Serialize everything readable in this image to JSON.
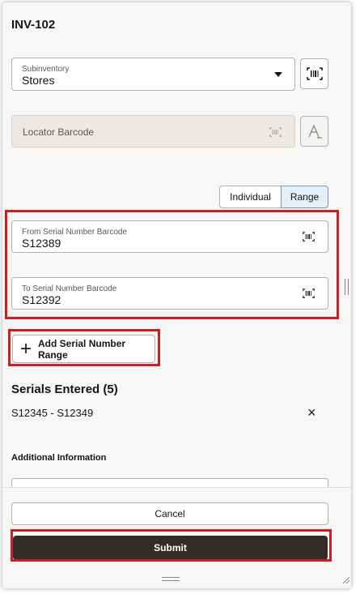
{
  "header": {
    "title": "INV-102"
  },
  "subinventory": {
    "label": "Subinventory",
    "value": "Stores"
  },
  "locator": {
    "placeholder": "Locator Barcode"
  },
  "mode_toggle": {
    "individual_label": "Individual",
    "range_label": "Range",
    "selected": "Range"
  },
  "from_serial": {
    "label": "From Serial Number Barcode",
    "value": "S12389"
  },
  "to_serial": {
    "label": "To Serial Number Barcode",
    "value": "S12392"
  },
  "add_range": {
    "label": "Add Serial Number Range"
  },
  "serials": {
    "heading": "Serials Entered (5)",
    "items": [
      {
        "range": "S12345 - S12349"
      }
    ]
  },
  "additional": {
    "heading": "Additional Information"
  },
  "actions": {
    "cancel_label": "Cancel",
    "submit_label": "Submit"
  },
  "icons": {
    "dropdown": "caret-down-icon",
    "barcode": "barcode-scan-icon",
    "text_entry": "text-entry-icon",
    "add": "plus-icon",
    "remove": "close-icon"
  },
  "colors": {
    "highlight": "#cc1f24",
    "primary_button": "#312d2a",
    "selected_segment": "#e4eff7"
  }
}
